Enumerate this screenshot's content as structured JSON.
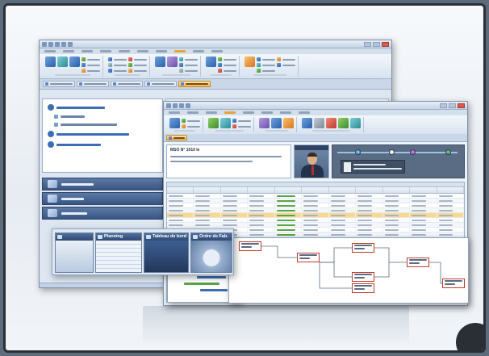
{
  "dashboard": {
    "appointment_header": "MSO N° 1010 le"
  },
  "thumbnails": [
    {
      "label": ""
    },
    {
      "label": "Planning"
    },
    {
      "label": "Tableau de bord"
    },
    {
      "label": "Ordre de Fab."
    }
  ]
}
